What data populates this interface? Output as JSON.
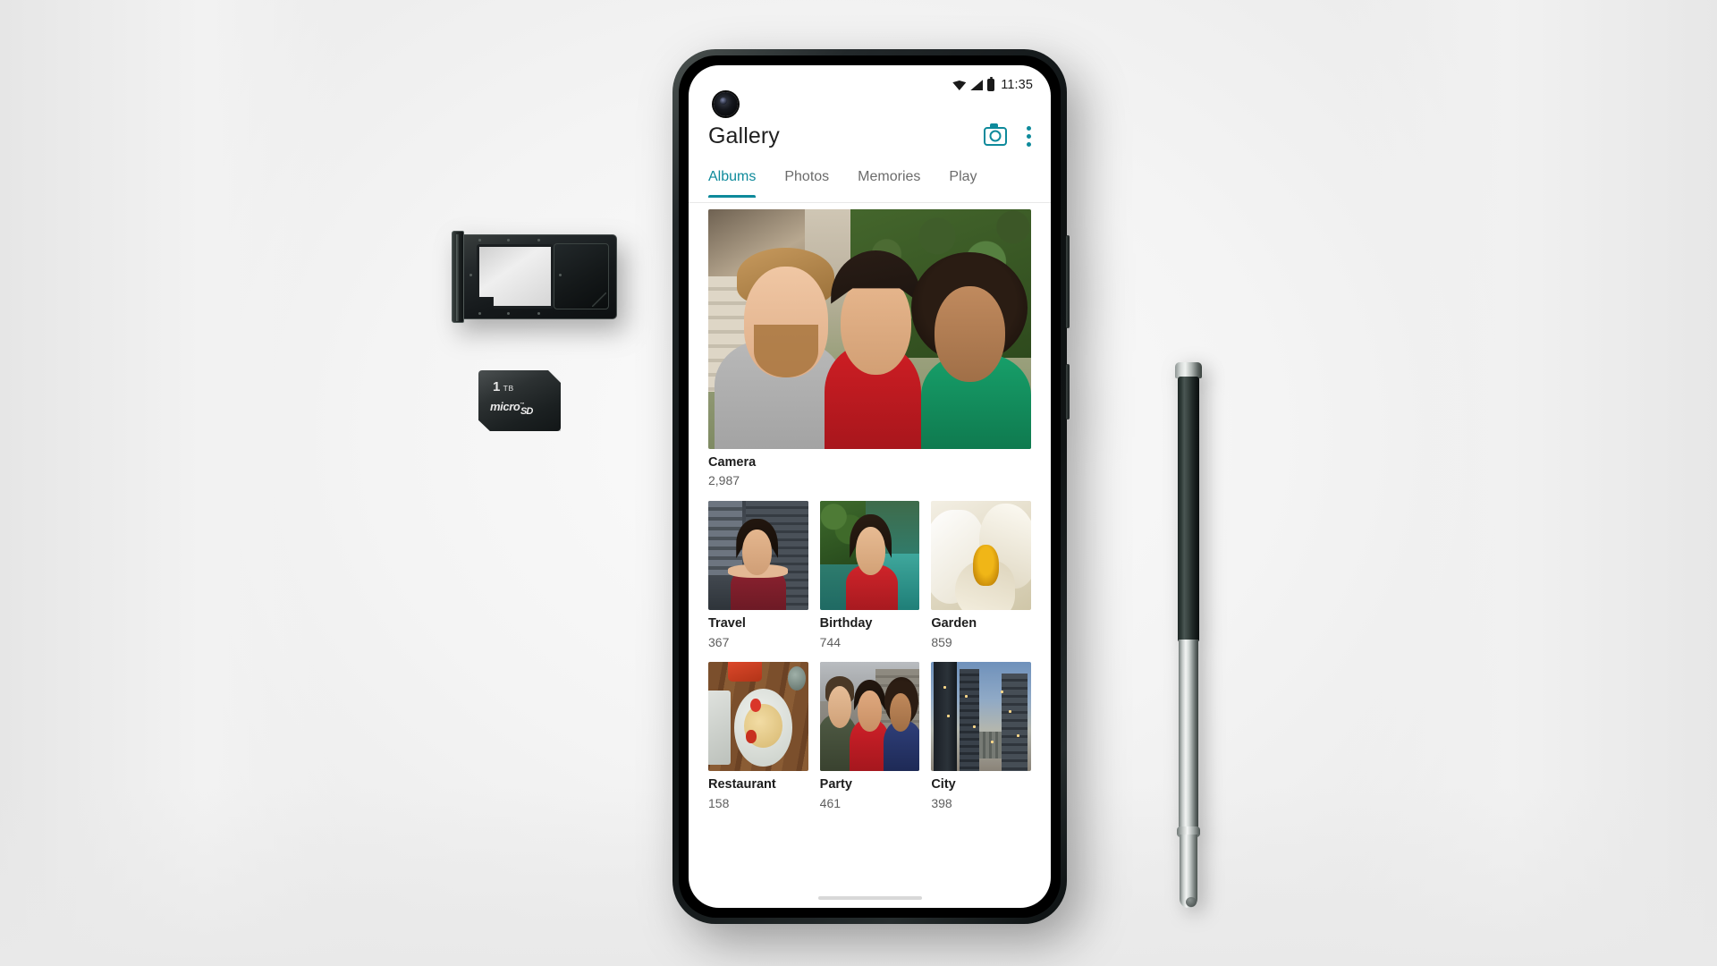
{
  "scene": {
    "objects": {
      "sim_tray": "dual-sim-microsd-tray",
      "sd_card": {
        "capacity": "1",
        "capacity_unit": "TB",
        "brand": "micro",
        "brand_mark": "SD",
        "trademark": "™"
      },
      "stylus": "capacitive-stylus-pen"
    }
  },
  "phone": {
    "status_bar": {
      "clock": "11:35",
      "icons": [
        "wifi-icon",
        "signal-icon",
        "battery-icon"
      ]
    },
    "app_bar": {
      "title": "Gallery",
      "actions": [
        {
          "name": "camera-icon",
          "label": "Camera"
        },
        {
          "name": "overflow-menu-icon",
          "label": "More options"
        }
      ],
      "accent_color": "#0e8a9b"
    },
    "tabs": [
      {
        "label": "Albums",
        "active": true
      },
      {
        "label": "Photos",
        "active": false
      },
      {
        "label": "Memories",
        "active": false
      },
      {
        "label": "Play",
        "active": false
      }
    ],
    "albums": {
      "hero": {
        "name": "Camera",
        "count": "2,987",
        "thumbnail": "selfie-three-friends-garden"
      },
      "grid": [
        {
          "name": "Travel",
          "count": "367",
          "thumbnail": "woman-red-top-city-building"
        },
        {
          "name": "Birthday",
          "count": "744",
          "thumbnail": "woman-red-dress-poolside"
        },
        {
          "name": "Garden",
          "count": "859",
          "thumbnail": "white-magnolia-flower"
        },
        {
          "name": "Restaurant",
          "count": "158",
          "thumbnail": "plate-of-food-wood-table"
        },
        {
          "name": "Party",
          "count": "461",
          "thumbnail": "three-friends-rooftop"
        },
        {
          "name": "City",
          "count": "398",
          "thumbnail": "skyscrapers-dusk-skyline"
        }
      ]
    }
  }
}
